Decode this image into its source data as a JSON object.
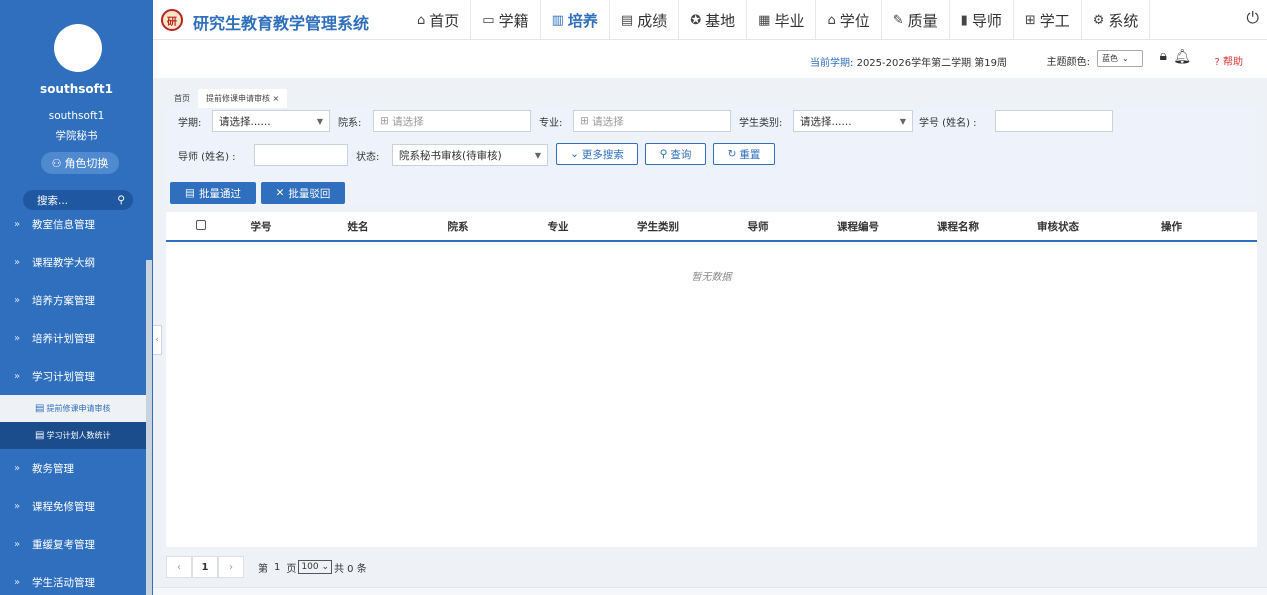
{
  "app": {
    "title": "研究生教育教学管理系统",
    "logo_text": "研"
  },
  "user": {
    "display_name": "southsoft1",
    "account": "southsoft1",
    "role": "学院秘书",
    "role_switch_label": "角色切换"
  },
  "sidebar_search": {
    "placeholder": "搜索..."
  },
  "menu": [
    {
      "label": "教室信息管理",
      "arrow": "»"
    },
    {
      "label": "课程教学大纲",
      "arrow": "»"
    },
    {
      "label": "培养方案管理",
      "arrow": "»"
    },
    {
      "label": "培养计划管理",
      "arrow": "»"
    },
    {
      "label": "学习计划管理",
      "arrow": "»"
    },
    {
      "label": "提前修课申请审核"
    },
    {
      "label": "学习计划人数统计"
    },
    {
      "label": "教务管理",
      "arrow": "»"
    },
    {
      "label": "课程免修管理",
      "arrow": "»"
    },
    {
      "label": "重缓复考管理",
      "arrow": "»"
    },
    {
      "label": "学生活动管理",
      "arrow": "»"
    }
  ],
  "nav": [
    {
      "label": "首页",
      "icon": "home-icon"
    },
    {
      "label": "学籍",
      "icon": "id-card-icon"
    },
    {
      "label": "培养",
      "icon": "book-icon"
    },
    {
      "label": "成绩",
      "icon": "report-icon"
    },
    {
      "label": "基地",
      "icon": "badge-icon"
    },
    {
      "label": "毕业",
      "icon": "certificate-icon"
    },
    {
      "label": "学位",
      "icon": "graduation-cap-icon"
    },
    {
      "label": "质量",
      "icon": "edit-icon"
    },
    {
      "label": "导师",
      "icon": "bar-chart-icon"
    },
    {
      "label": "学工",
      "icon": "grid-icon"
    },
    {
      "label": "系统",
      "icon": "gear-icon"
    }
  ],
  "subbar": {
    "term_label": "当前学期",
    "term_value": "2025-2026学年第二学期 第19周",
    "theme_label": "主题颜色:",
    "theme_value": "蓝色",
    "help_label": "帮助"
  },
  "tabs": {
    "home": "首页",
    "current": "提前修课申请审核"
  },
  "filters": {
    "term_label": "学期:",
    "term_value": "请选择......",
    "dept_label": "院系:",
    "dept_placeholder": "请选择",
    "major_label": "专业:",
    "major_placeholder": "请选择",
    "stutype_label": "学生类别:",
    "stutype_value": "请选择......",
    "stuno_label": "学号 (姓名) :",
    "stuno_value": "",
    "tutor_label": "导师 (姓名) :",
    "tutor_value": "",
    "status_label": "状态:",
    "status_value": "院系秘书审核(待审核)",
    "more_label": "更多搜索",
    "query_label": "查询",
    "reset_label": "重置",
    "batch_pass_label": "批量通过",
    "batch_reject_label": "批量驳回"
  },
  "table": {
    "columns": [
      "学号",
      "姓名",
      "院系",
      "专业",
      "学生类别",
      "导师",
      "课程编号",
      "课程名称",
      "审核状态",
      "操作"
    ],
    "empty_text": "暂无数据"
  },
  "pager": {
    "current_page": "1",
    "page_text_prefix": "第",
    "page_text_mid": "1",
    "page_text_suffix": "页",
    "page_size": "100",
    "total_text": "共 0 条"
  },
  "colors": {
    "primary": "#2f6fbd",
    "sidebar_dark": "#1b4d8c"
  }
}
